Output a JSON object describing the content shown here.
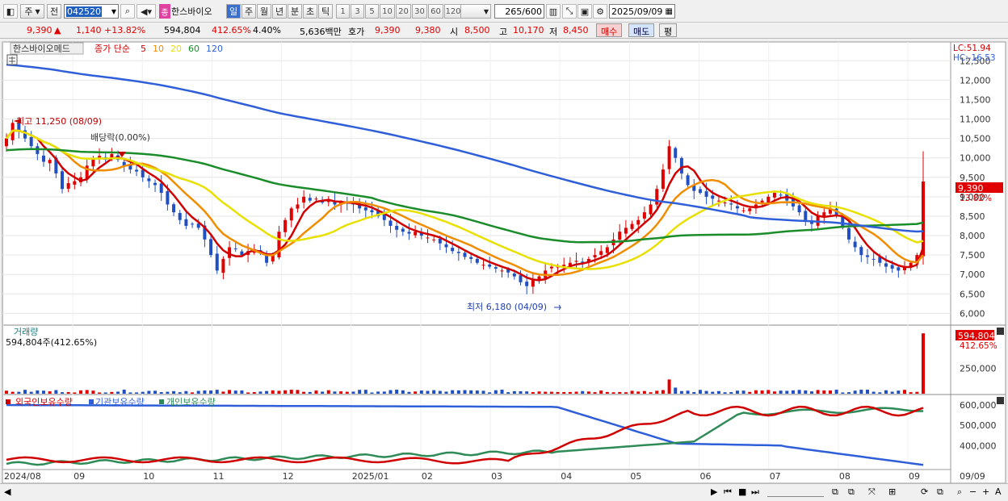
{
  "toolbar": {
    "period_label": "주",
    "prev_label": "전",
    "stock_code": "042520",
    "stock_badge": "종",
    "stock_name": "한스바이오",
    "timeframes": [
      "일",
      "주",
      "월",
      "년",
      "분",
      "초",
      "틱"
    ],
    "minute_steps": [
      "1",
      "3",
      "5",
      "10",
      "20",
      "30",
      "60",
      "120"
    ],
    "count_value": "265",
    "count_total": "/600",
    "date_value": "2025/09/09"
  },
  "quote": {
    "price": "9,390",
    "arrow": "▲",
    "change": "1,140",
    "change_pct": "+13.82%",
    "volume": "594,804",
    "volume_ratio": "412.65%",
    "turnover_rate": "4.40%",
    "amount": "5,636백만",
    "bid_label": "호가",
    "bid1": "9,390",
    "bid2": "9,380",
    "open_label": "시",
    "open": "8,500",
    "high_label": "고",
    "high": "10,170",
    "low_label": "저",
    "low": "8,450",
    "buy_button": "매수",
    "sell_button": "매도",
    "eval_button": "평"
  },
  "price_panel": {
    "stock_tab": "한스바이오메드",
    "ma_title": "종가 단순",
    "ma_periods": [
      {
        "label": "5",
        "color": "#d00000"
      },
      {
        "label": "10",
        "color": "#f08c00"
      },
      {
        "label": "20",
        "color": "#e8e000"
      },
      {
        "label": "60",
        "color": "#1a8c2a"
      },
      {
        "label": "120",
        "color": "#2f5fd8"
      }
    ],
    "lc_label": "LC:51.94",
    "hc_label": "HC:-16.53",
    "y_ticks": [
      "12,500",
      "12,000",
      "11,500",
      "11,000",
      "10,500",
      "10,000",
      "9,500",
      "9,000",
      "8,500",
      "8,000",
      "7,500",
      "7,000",
      "6,500",
      "6,000"
    ],
    "current_price_tag": "9,390",
    "current_change_tag": "13.82%",
    "high_annotation": "최고 11,250 (08/09)",
    "dividend_annotation": "배당락(0.00%)",
    "low_annotation": "최저 6,180 (04/09)"
  },
  "volume_panel": {
    "title": "거래량",
    "value_label": "594,804주(412.65%)",
    "tag_value": "594,804",
    "tag_pct": "412.65%",
    "y_tick": "250,000"
  },
  "holding_panel": {
    "foreign_label": "외국인보유수량",
    "inst_label": "기관보유수량",
    "indiv_label": "개인보유수량",
    "y_ticks": [
      "600,000",
      "500,000",
      "400,000"
    ],
    "colors": {
      "foreign": "#d00000",
      "inst": "#2f5fd8",
      "indiv": "#2e8b57"
    }
  },
  "x_axis": {
    "labels": [
      "2024/08",
      "09",
      "10",
      "11",
      "12",
      "2025/01",
      "02",
      "03",
      "04",
      "05",
      "06",
      "07",
      "08",
      "09"
    ],
    "right_date": "09/09"
  },
  "chart_data": {
    "type": "candlestick",
    "period": "weekly",
    "high": {
      "value": 11250,
      "date": "08/09"
    },
    "low": {
      "value": 6180,
      "date": "04/09"
    },
    "last": {
      "open": 8500,
      "high": 10170,
      "low": 8450,
      "close": 9390,
      "volume": 594804
    },
    "ylim": [
      5800,
      12900
    ],
    "close_series": [
      10500,
      10900,
      10700,
      10500,
      10300,
      10100,
      9900,
      9950,
      9600,
      9200,
      9350,
      9400,
      9500,
      9800,
      10000,
      10050,
      9950,
      10100,
      9950,
      9800,
      9700,
      9650,
      9500,
      9400,
      9300,
      9100,
      8800,
      8600,
      8400,
      8250,
      8300,
      8200,
      7900,
      7500,
      7100,
      7400,
      7700,
      7650,
      7500,
      7600,
      7650,
      7550,
      7300,
      7500,
      8100,
      8400,
      8700,
      8800,
      9000,
      8900,
      8950,
      8850,
      8900,
      8800,
      8850,
      8850,
      8800,
      8700,
      8650,
      8600,
      8500,
      8400,
      8250,
      8150,
      8100,
      8050,
      8100,
      8000,
      7950,
      7900,
      7800,
      7700,
      7600,
      7550,
      7450,
      7400,
      7300,
      7250,
      7200,
      7150,
      7100,
      7050,
      6950,
      6800,
      6700,
      6850,
      6950,
      7100,
      7200,
      7200,
      7250,
      7300,
      7350,
      7300,
      7400,
      7500,
      7600,
      7700,
      7900,
      8100,
      8200,
      8300,
      8400,
      8600,
      8800,
      9200,
      9700,
      10300,
      10000,
      9600,
      9300,
      9150,
      9100,
      9000,
      8950,
      8900,
      8850,
      8800,
      8700,
      8650,
      8700,
      8800,
      8900,
      9000,
      9100,
      9050,
      8900,
      8750,
      8600,
      8400,
      8300,
      8500,
      8600,
      8700,
      8500,
      8200,
      7900,
      7700,
      7500,
      7450,
      7400,
      7300,
      7200,
      7150,
      7100,
      7200,
      7300,
      7500,
      9390
    ],
    "ma": {
      "ma60_start": 10200,
      "ma120_start": 12400
    },
    "holdings": {
      "foreign_range": [
        290000,
        600000
      ],
      "inst_range": [
        290000,
        600000
      ],
      "indiv_range": [
        290000,
        600000
      ]
    }
  }
}
